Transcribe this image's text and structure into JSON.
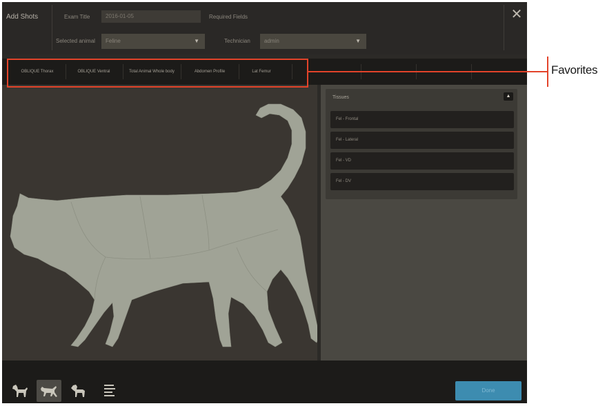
{
  "header": {
    "title": "Add Shots",
    "exam_title_label": "Exam Title",
    "exam_title_value": "2016-01-05",
    "required_fields_label": "Required Fields",
    "selected_animal_label": "Selected animal",
    "selected_animal_value": "Feline",
    "technician_label": "Technician",
    "technician_value": "admin"
  },
  "favorites": {
    "items": [
      "OBLIQUE Thorax",
      "OBLIQUE Ventral",
      "Total Animal Whole body",
      "Abdomen Profile",
      "Lat Femur"
    ]
  },
  "callout": {
    "label": "Favorites"
  },
  "tissues": {
    "title": "Tissues",
    "items": [
      "Fel - Frontal",
      "Fel - Lateral",
      "Fel - VD",
      "Fel - DV"
    ]
  },
  "footer": {
    "view_buttons": [
      "dog-view-icon",
      "cat-view-icon",
      "horse-view-icon",
      "list-view-icon"
    ],
    "done_label": "Done"
  },
  "colors": {
    "callout": "#e3432a",
    "done": "#3d8cb0",
    "silhouette": "#a0a396"
  }
}
